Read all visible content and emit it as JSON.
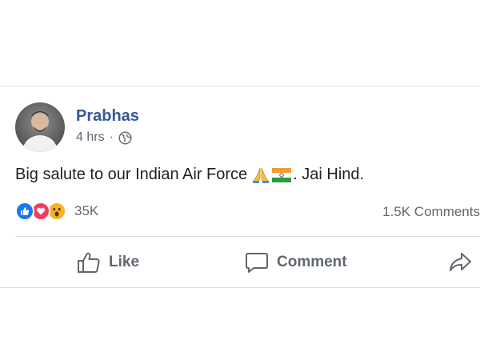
{
  "post": {
    "author": "Prabhas",
    "time": "4 hrs",
    "separator": "·",
    "text_before": "Big salute to our Indian Air Force",
    "text_after": ". Jai Hind.",
    "reaction_count": "35K",
    "comments_count": "1.5K Comments"
  },
  "actions": {
    "like_label": "Like",
    "comment_label": "Comment"
  },
  "icons": {
    "privacy": "globe-icon",
    "emoji_1": "folded-hands-icon",
    "emoji_2": "india-flag-icon",
    "reactions": [
      "like-reaction-icon",
      "love-reaction-icon",
      "wow-reaction-icon"
    ],
    "share": "share-arrow-icon"
  },
  "colors": {
    "author": "#365899",
    "meta": "#616770",
    "like_reaction": "#1877f2",
    "love_reaction": "#f33e58",
    "wow_reaction": "#f7b125"
  }
}
